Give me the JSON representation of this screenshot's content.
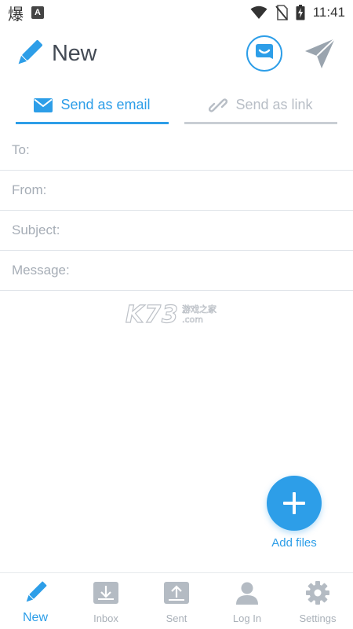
{
  "status_bar": {
    "left_glyph": "爆",
    "left_badge": "A",
    "time": "11:41"
  },
  "header": {
    "title": "New",
    "title_icon": "pencil-icon",
    "support_icon": "chat-smile-icon",
    "send_icon": "paper-plane-icon"
  },
  "tabs": [
    {
      "label": "Send as email",
      "icon": "envelope-icon",
      "active": true
    },
    {
      "label": "Send as link",
      "icon": "link-icon",
      "active": false
    }
  ],
  "form": {
    "to_placeholder": "To:",
    "from_placeholder": "From:",
    "subject_placeholder": "Subject:",
    "message_placeholder": "Message:"
  },
  "watermark": {
    "mark": "K73",
    "line1": "游戏之家",
    "line2": ".com"
  },
  "fab": {
    "label": "Add files",
    "icon": "plus-icon"
  },
  "bottom_nav": {
    "items": [
      {
        "label": "New",
        "icon": "pencil-icon",
        "active": true
      },
      {
        "label": "Inbox",
        "icon": "inbox-download-icon",
        "active": false
      },
      {
        "label": "Sent",
        "icon": "sent-upload-icon",
        "active": false
      },
      {
        "label": "Log In",
        "icon": "user-icon",
        "active": false
      },
      {
        "label": "Settings",
        "icon": "gear-icon",
        "active": false
      }
    ]
  },
  "colors": {
    "accent": "#2d9ee8",
    "muted": "#a9b0b8",
    "divider": "#e1e5ea",
    "title": "#444b55"
  }
}
